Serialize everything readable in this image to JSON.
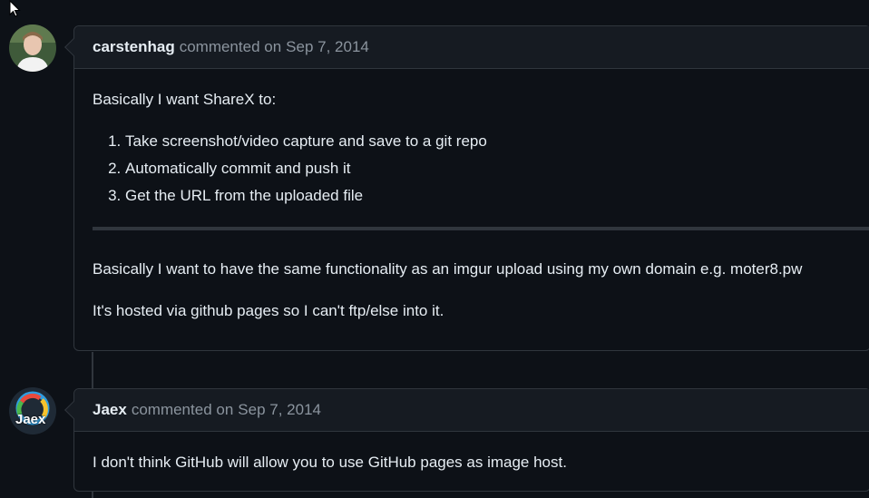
{
  "comments": [
    {
      "author": "carstenhag",
      "action": "commented on",
      "date": "Sep 7, 2014",
      "intro": "Basically I want ShareX to:",
      "steps": [
        "Take screenshot/video capture and save to a git repo",
        "Automatically commit and push it",
        "Get the URL from the uploaded file"
      ],
      "paragraph1": "Basically I want to have the same functionality as an imgur upload using my own domain e.g. moter8.pw",
      "paragraph2": "It's hosted via github pages so I can't ftp/else into it."
    },
    {
      "author": "Jaex",
      "action": "commented on",
      "date": "Sep 7, 2014",
      "avatar_text": "Jaex",
      "body": "I don't think GitHub will allow you to use GitHub pages as image host."
    }
  ],
  "colors": {
    "background": "#0d1117",
    "header_bg": "#161b22",
    "border": "#30363d",
    "text": "#e6edf3",
    "muted": "#8b949e"
  }
}
